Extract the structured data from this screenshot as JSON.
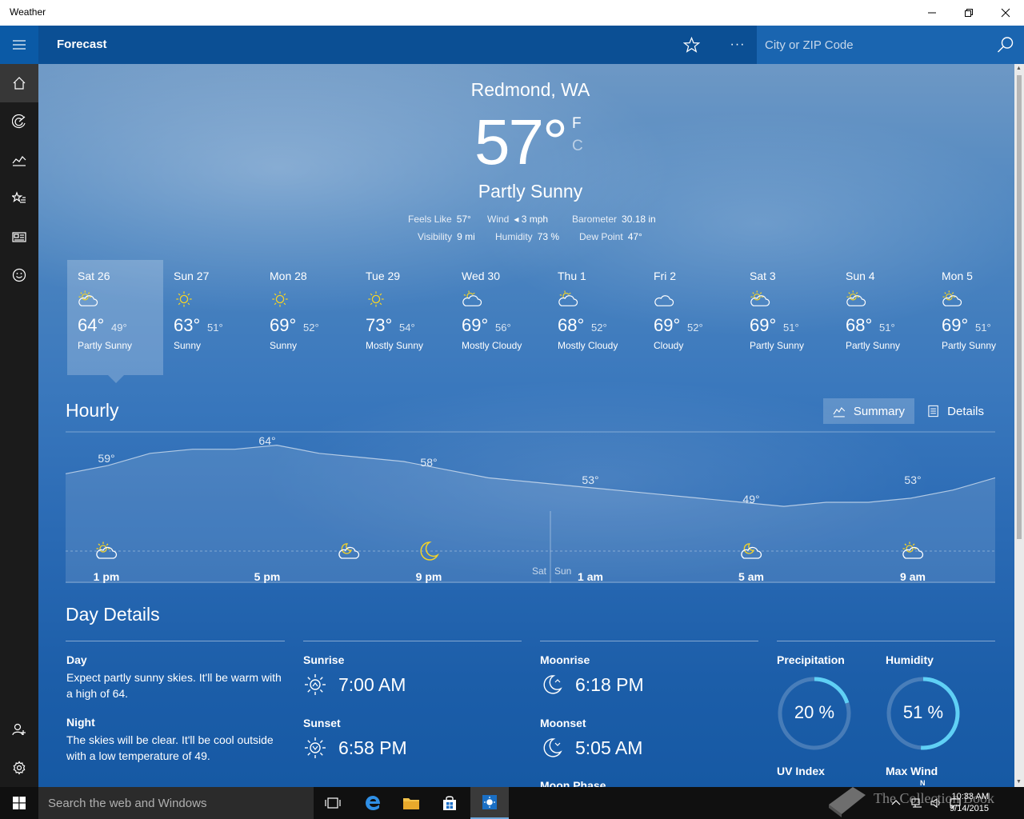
{
  "window": {
    "title": "Weather"
  },
  "header": {
    "title": "Forecast",
    "more_label": "···",
    "search_placeholder": "City or ZIP Code"
  },
  "current": {
    "location": "Redmond, WA",
    "temp": "57°",
    "unit_f": "F",
    "unit_c": "C",
    "condition": "Partly Sunny",
    "stats": [
      {
        "label": "Feels Like",
        "value": "57°"
      },
      {
        "label": "Wind",
        "value": "◂ 3 mph"
      },
      {
        "label": "Barometer",
        "value": "30.18 in"
      },
      {
        "label": "Visibility",
        "value": "9 mi"
      },
      {
        "label": "Humidity",
        "value": "73 %"
      },
      {
        "label": "Dew Point",
        "value": "47°"
      }
    ]
  },
  "daily": [
    {
      "name": "Sat 26",
      "icon": "partly-sunny-icon",
      "hi": "64°",
      "lo": "49°",
      "cond": "Partly Sunny"
    },
    {
      "name": "Sun 27",
      "icon": "sunny-icon",
      "hi": "63°",
      "lo": "51°",
      "cond": "Sunny"
    },
    {
      "name": "Mon 28",
      "icon": "sunny-icon",
      "hi": "69°",
      "lo": "52°",
      "cond": "Sunny"
    },
    {
      "name": "Tue 29",
      "icon": "sunny-icon",
      "hi": "73°",
      "lo": "54°",
      "cond": "Mostly Sunny"
    },
    {
      "name": "Wed 30",
      "icon": "mostly-cloudy-icon",
      "hi": "69°",
      "lo": "56°",
      "cond": "Mostly Cloudy"
    },
    {
      "name": "Thu 1",
      "icon": "mostly-cloudy-icon",
      "hi": "68°",
      "lo": "52°",
      "cond": "Mostly Cloudy"
    },
    {
      "name": "Fri 2",
      "icon": "cloudy-icon",
      "hi": "69°",
      "lo": "52°",
      "cond": "Cloudy"
    },
    {
      "name": "Sat 3",
      "icon": "partly-sunny-icon",
      "hi": "69°",
      "lo": "51°",
      "cond": "Partly Sunny"
    },
    {
      "name": "Sun 4",
      "icon": "partly-sunny-icon",
      "hi": "68°",
      "lo": "51°",
      "cond": "Partly Sunny"
    },
    {
      "name": "Mon 5",
      "icon": "partly-sunny-icon",
      "hi": "69°",
      "lo": "51°",
      "cond": "Partly Sunny"
    }
  ],
  "hourly": {
    "title": "Hourly",
    "summary_label": "Summary",
    "details_label": "Details",
    "temp_labels": [
      "59°",
      "64°",
      "58°",
      "53°",
      "49°",
      "53°"
    ],
    "time_labels": [
      "1 pm",
      "5 pm",
      "9 pm",
      "1 am",
      "5 am",
      "9 am"
    ],
    "day_split": [
      "Sat",
      "Sun"
    ],
    "icons": [
      "partly-sunny-icon",
      "partly-cloudy-night-icon",
      "moon-icon",
      "partly-cloudy-night-icon",
      "partly-sunny-icon"
    ]
  },
  "day_details": {
    "title": "Day Details",
    "day_label": "Day",
    "day_text": "Expect partly sunny skies. It'll be warm with a high of 64.",
    "night_label": "Night",
    "night_text": "The skies will be clear. It'll be cool outside with a low temperature of 49.",
    "sunrise_label": "Sunrise",
    "sunrise": "7:00 AM",
    "sunset_label": "Sunset",
    "sunset": "6:58 PM",
    "moonrise_label": "Moonrise",
    "moonrise": "6:18 PM",
    "moonset_label": "Moonset",
    "moonset": "5:05 AM",
    "moonphase_label": "Moon Phase",
    "precip_label": "Precipitation",
    "precip": "20 %",
    "precip_fraction": 0.2,
    "humidity_label": "Humidity",
    "humidity": "51 %",
    "humidity_fraction": 0.51,
    "uv_label": "UV Index",
    "wind_label": "Max Wind",
    "wind_n": "N"
  },
  "taskbar": {
    "search_placeholder": "Search the web and Windows",
    "time": "10:33 AM",
    "date": "9/14/2015",
    "watermark": "The Collection Book"
  },
  "colors": {
    "accent": "#0b5aa6",
    "ring": "#5fd0f5",
    "sun": "#f5d326"
  }
}
